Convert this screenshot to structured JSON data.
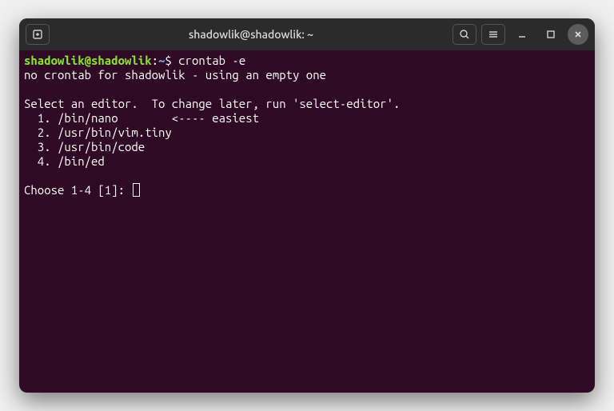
{
  "titlebar": {
    "title": "shadowlik@shadowlik: ~"
  },
  "prompt": {
    "user_host": "shadowlik@shadowlik",
    "separator": ":",
    "path": "~",
    "symbol": "$"
  },
  "command": "crontab -e",
  "output": {
    "no_crontab": "no crontab for shadowlik - using an empty one",
    "blank1": "",
    "select_editor": "Select an editor.  To change later, run 'select-editor'.",
    "option1": "  1. /bin/nano        <---- easiest",
    "option2": "  2. /usr/bin/vim.tiny",
    "option3": "  3. /usr/bin/code",
    "option4": "  4. /bin/ed",
    "blank2": "",
    "choose_prompt": "Choose 1-4 [1]: "
  }
}
